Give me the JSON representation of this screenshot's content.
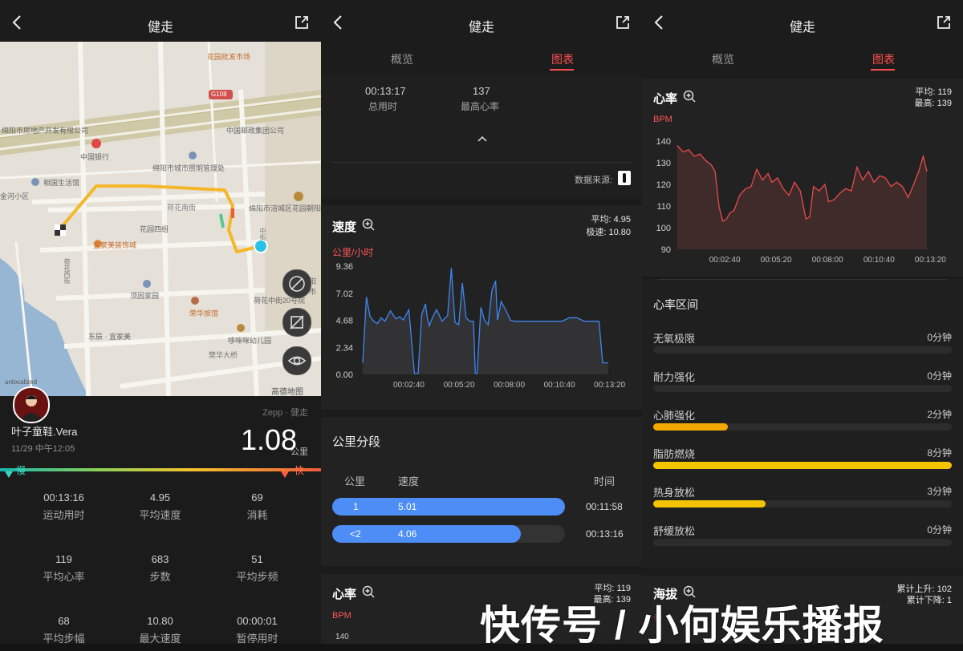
{
  "screen1": {
    "title": "健走",
    "map_labels": {
      "market": "花园批发市场",
      "road_g108": "G108",
      "realestate": "绵阳市房地产开发有限公司",
      "postal": "中国邮政集团公司",
      "bank": "中国银行",
      "lighting": "绵阳市城市照明管理处",
      "life_hall": "相国生活馆",
      "jinhe": "金河小区",
      "hehua_south": "荷花南街",
      "court": "绵阳市涪城区花园朝阳",
      "garden4": "花园四组",
      "yijia": "宜家美装饰城",
      "hehua_west": "荷花西街",
      "dingyuan": "顶固家园",
      "ronghua": "荣华旅馆",
      "hehua_mid": "荷花中街20号院",
      "dongchen": "东辰 · 宜家美",
      "kindergarten": "哆咪咪幼儿园",
      "bridge": "樊华大桥",
      "amap": "高德地图",
      "unlocalized": "unlocalized",
      "cut_label": "阳市",
      "shop": "中街"
    },
    "user_name": "叶子童鞋.Vera",
    "datetime": "11/29 中午12:05",
    "source": "Zepp · 健走",
    "distance": "1.08",
    "distance_unit": "公里",
    "slow_label": "慢",
    "fast_label": "快",
    "stats": [
      {
        "value": "00:13:16",
        "label": "运动用时"
      },
      {
        "value": "4.95",
        "label": "平均速度"
      },
      {
        "value": "69",
        "label": "消耗"
      },
      {
        "value": "119",
        "label": "平均心率"
      },
      {
        "value": "683",
        "label": "步数"
      },
      {
        "value": "51",
        "label": "平均步频"
      },
      {
        "value": "68",
        "label": "平均步幅"
      },
      {
        "value": "10.80",
        "label": "最大速度"
      },
      {
        "value": "00:00:01",
        "label": "暂停用时"
      }
    ]
  },
  "screen2": {
    "title": "健走",
    "tab_overview": "概览",
    "tab_charts": "图表",
    "total_time": "00:13:17",
    "total_time_label": "总用时",
    "max_hr": "137",
    "max_hr_label": "最高心率",
    "data_source_label": "数据来源:",
    "speed_title": "速度",
    "speed_avg": "平均: 4.95",
    "speed_max": "极速: 10.80",
    "speed_unit": "公里/小时",
    "km_split_title": "公里分段",
    "col_km": "公里",
    "col_speed": "速度",
    "col_time": "时间",
    "splits": [
      {
        "km": "1",
        "speed": "5.01",
        "time": "00:11:58",
        "fraction": 1.0
      },
      {
        "km": "<2",
        "speed": "4.06",
        "time": "00:13:16",
        "fraction": 0.81
      }
    ],
    "hr_title": "心率",
    "hr_avg": "平均: 119",
    "hr_max": "最高: 139",
    "bpm": "BPM",
    "hr_first_tick": "140"
  },
  "screen3": {
    "title": "健走",
    "tab_overview": "概览",
    "tab_charts": "图表",
    "hr_title": "心率",
    "hr_avg": "平均: 119",
    "hr_max": "最高: 139",
    "bpm": "BPM",
    "zones_title": "心率区间",
    "zones": [
      {
        "name": "无氧极限",
        "value": "0分钟",
        "fraction": 0,
        "color": "#f5c400"
      },
      {
        "name": "耐力强化",
        "value": "0分钟",
        "fraction": 0,
        "color": "#f5c400"
      },
      {
        "name": "心肺强化",
        "value": "2分钟",
        "fraction": 0.25,
        "color": "#f5a800"
      },
      {
        "name": "脂肪燃烧",
        "value": "8分钟",
        "fraction": 1.0,
        "color": "#f5c400"
      },
      {
        "name": "热身放松",
        "value": "3分钟",
        "fraction": 0.375,
        "color": "#f5c400"
      },
      {
        "name": "舒缓放松",
        "value": "0分钟",
        "fraction": 0,
        "color": "#f5c400"
      }
    ],
    "altitude_title": "海拔",
    "altitude_up": "累计上升: 102",
    "altitude_down": "累计下降: 1"
  },
  "watermark": "快传号 / 小何娱乐播报",
  "chart_data": [
    {
      "type": "line",
      "title": "速度",
      "ylabel": "公里/小时",
      "ylim": [
        0,
        9.36
      ],
      "yticks": [
        "9.36",
        "7.02",
        "4.68",
        "2.34",
        "0.00"
      ],
      "xticks": [
        "00:02:40",
        "00:05:20",
        "00:08:00",
        "00:10:40",
        "00:13:20"
      ],
      "x_minutes": [
        0.0,
        0.2,
        0.4,
        0.6,
        0.8,
        1.0,
        1.2,
        1.5,
        1.8,
        2.0,
        2.2,
        2.5,
        2.8,
        3.0,
        3.2,
        3.4,
        3.5,
        3.6,
        3.8,
        4.0,
        4.3,
        4.6,
        4.8,
        5.0,
        5.2,
        5.4,
        5.6,
        5.8,
        6.0,
        6.1,
        6.2,
        6.4,
        6.6,
        6.8,
        7.0,
        7.2,
        7.3,
        7.5,
        7.8,
        8.0,
        8.2,
        8.4,
        8.6,
        8.8,
        9.0,
        9.3,
        9.6,
        10.0,
        10.4,
        10.8,
        11.2,
        11.6,
        12.0,
        12.4,
        12.8,
        13.0,
        13.1,
        13.3
      ],
      "values": [
        1.0,
        6.7,
        5.0,
        4.6,
        4.4,
        4.9,
        4.6,
        5.5,
        4.8,
        5.0,
        4.7,
        5.6,
        0.1,
        0.1,
        5.2,
        6.1,
        4.9,
        4.2,
        5.0,
        5.6,
        4.6,
        5.1,
        9.2,
        4.5,
        4.3,
        7.9,
        4.9,
        4.6,
        4.6,
        0.1,
        0.1,
        5.8,
        4.7,
        4.3,
        7.3,
        8.1,
        4.7,
        6.3,
        5.4,
        4.7,
        4.6,
        4.6,
        4.6,
        4.6,
        4.6,
        4.6,
        4.6,
        4.6,
        4.6,
        4.6,
        4.9,
        4.9,
        4.6,
        4.6,
        4.6,
        1.0,
        1.0,
        1.0
      ]
    },
    {
      "type": "line",
      "title": "心率",
      "ylabel": "BPM",
      "ylim": [
        90,
        140
      ],
      "yticks": [
        "140",
        "130",
        "120",
        "110",
        "100",
        "90"
      ],
      "xticks": [
        "00:02:40",
        "00:05:20",
        "00:08:00",
        "00:10:40",
        "00:13:20"
      ],
      "x_minutes": [
        0.0,
        0.3,
        0.6,
        0.9,
        1.2,
        1.5,
        1.8,
        2.0,
        2.2,
        2.4,
        2.6,
        2.8,
        3.0,
        3.3,
        3.6,
        3.9,
        4.2,
        4.5,
        4.8,
        5.0,
        5.3,
        5.6,
        5.9,
        6.2,
        6.5,
        6.8,
        7.0,
        7.2,
        7.5,
        7.8,
        8.0,
        8.3,
        8.6,
        8.9,
        9.2,
        9.5,
        9.8,
        10.1,
        10.4,
        10.7,
        11.0,
        11.3,
        11.6,
        11.9,
        12.2,
        12.5,
        12.8,
        13.0,
        13.2
      ],
      "values": [
        138,
        135,
        136,
        133,
        134,
        131,
        129,
        126,
        110,
        103,
        104,
        107,
        108,
        115,
        118,
        119,
        127,
        122,
        125,
        121,
        123,
        118,
        115,
        121,
        117,
        104,
        105,
        119,
        117,
        120,
        112,
        113,
        116,
        118,
        117,
        128,
        122,
        126,
        121,
        124,
        123,
        119,
        121,
        119,
        114,
        120,
        127,
        133,
        126
      ]
    }
  ]
}
